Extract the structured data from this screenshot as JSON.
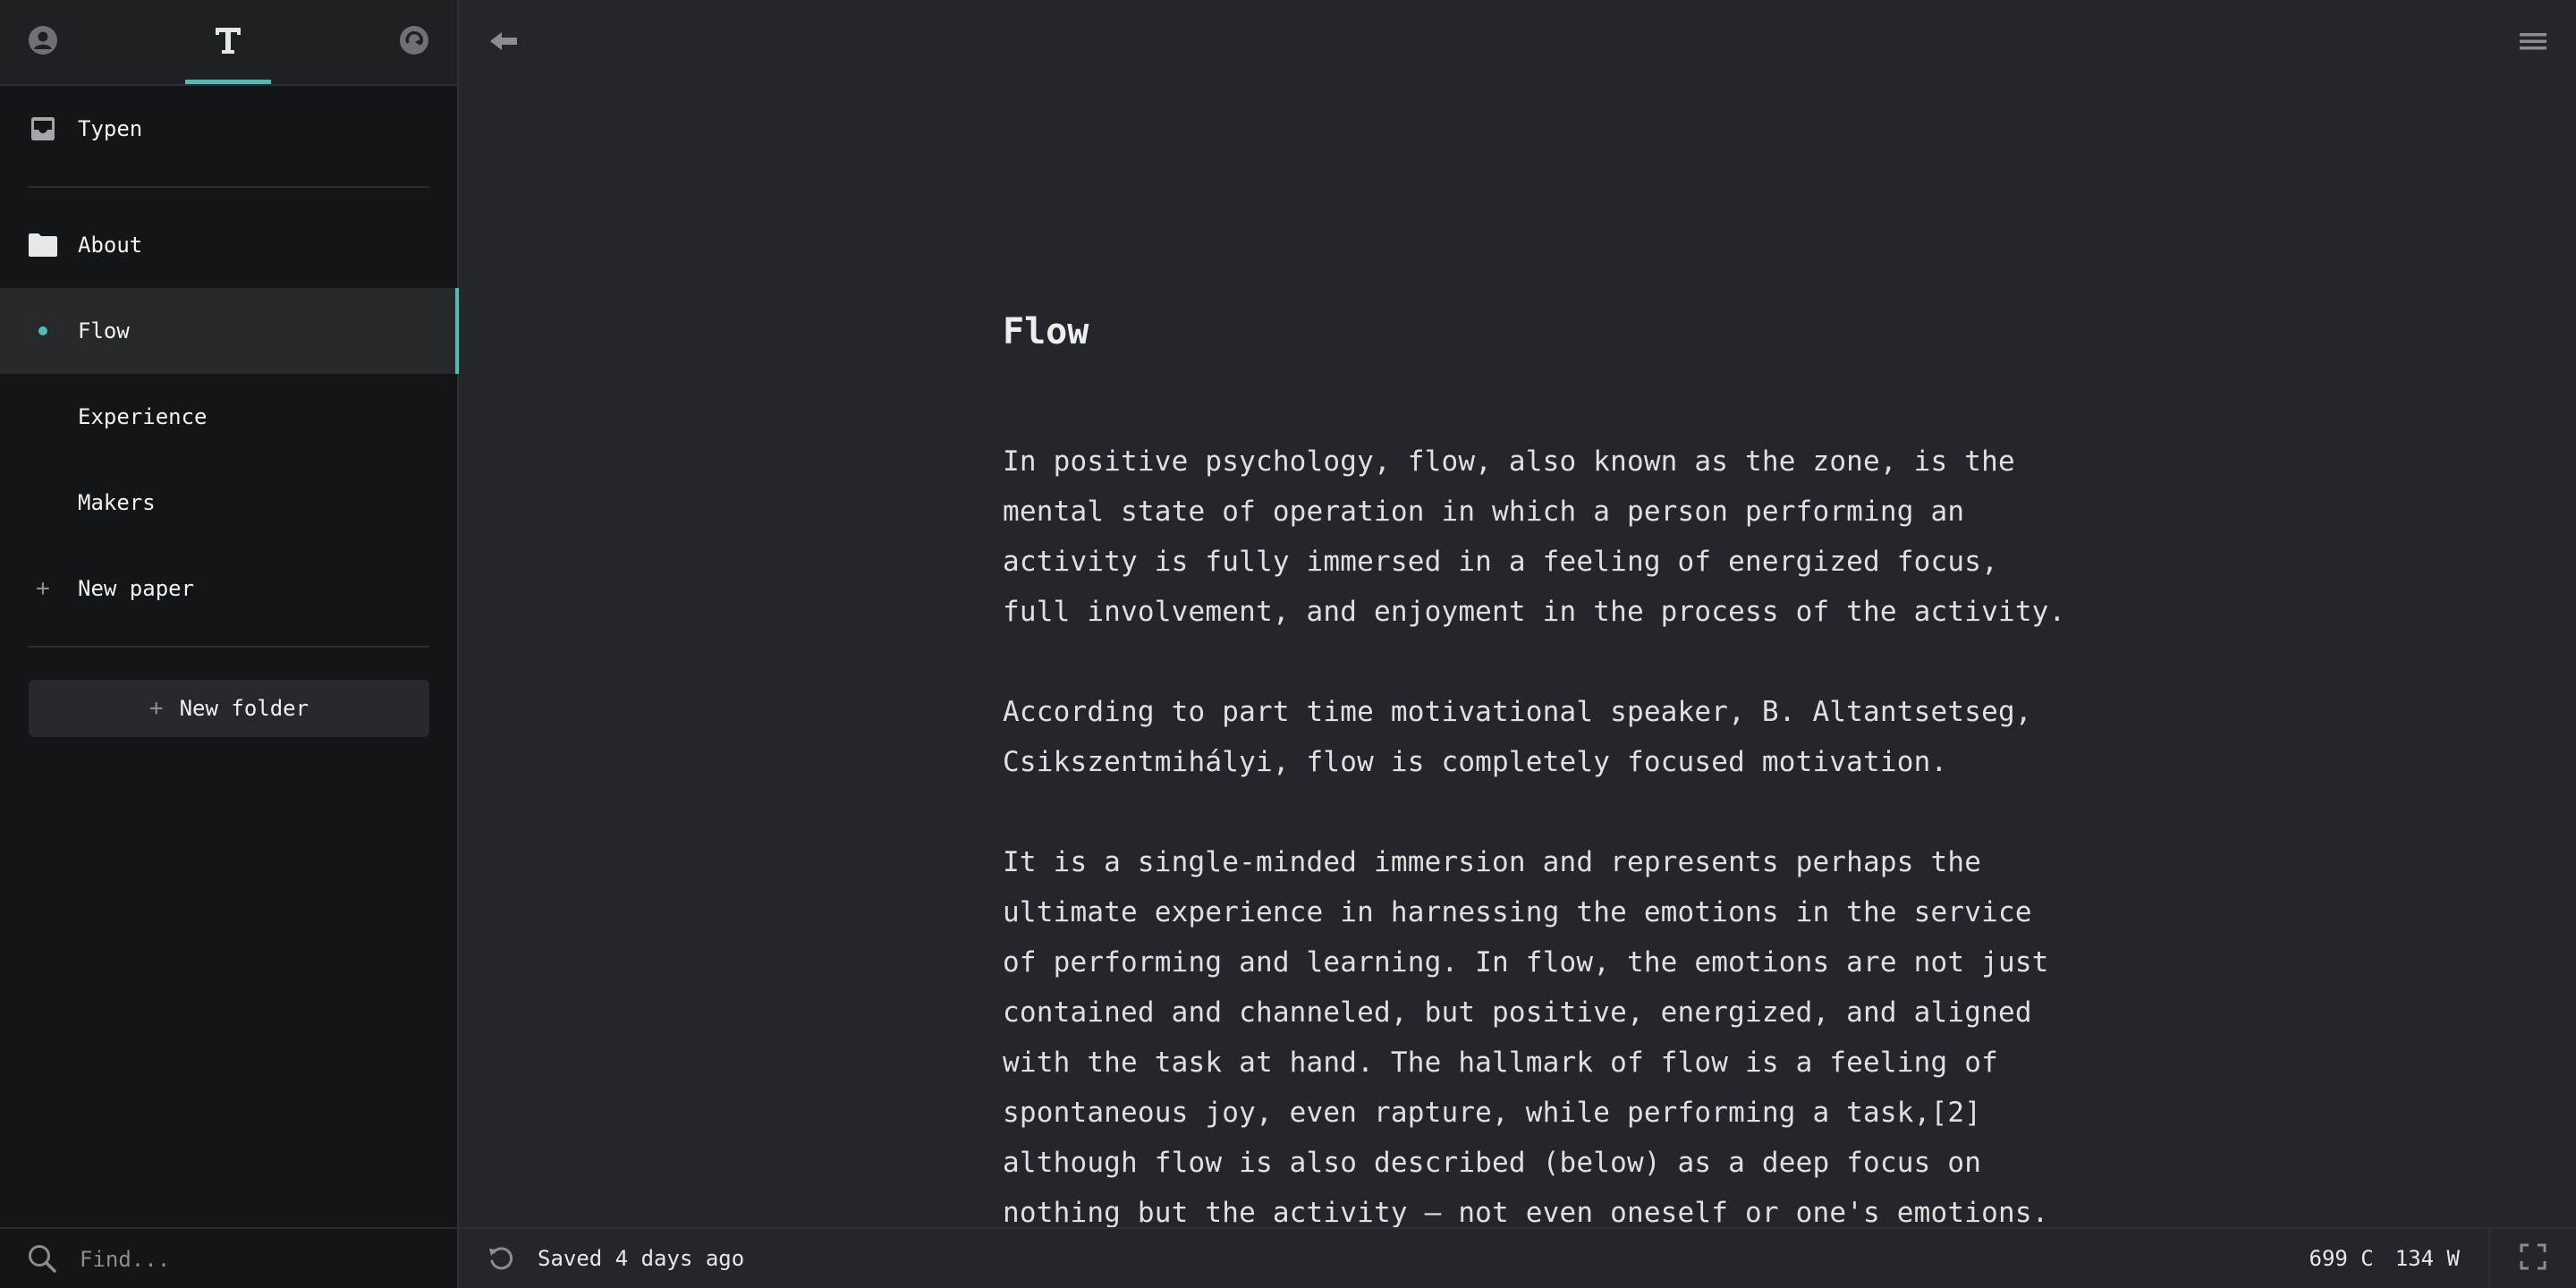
{
  "sidebar": {
    "tabs": [
      {
        "name": "user-icon"
      },
      {
        "name": "text-icon",
        "active": true
      },
      {
        "name": "sync-icon"
      }
    ],
    "inbox_label": "Typen",
    "folder_label": "About",
    "papers": [
      {
        "label": "Flow",
        "active": true
      },
      {
        "label": "Experience"
      },
      {
        "label": "Makers"
      }
    ],
    "new_paper_label": "New paper",
    "new_folder_label": "New folder",
    "find_placeholder": "Find..."
  },
  "document": {
    "title": "Flow",
    "paragraphs": [
      "In positive psychology, flow, also known as the zone, is the mental state of operation in which a person performing an activity is fully immersed in a feeling of energized focus, full involvement, and enjoyment in the process of the activity.",
      "According to part time motivational speaker, B. Altantsetseg, Csikszentmihályi, flow is completely focused motivation.",
      "It is a single-minded immersion and represents perhaps the ultimate experience in harnessing the emotions in the service of performing and learning. In flow, the emotions are not just contained and channeled, but positive, energized, and aligned with the task at hand. The hallmark of flow is a feeling of spontaneous joy, even rapture, while performing a task,[2] although flow is also described (below) as a deep focus on nothing but the activity – not even oneself or one's emotions."
    ]
  },
  "status": {
    "saved_text": "Saved 4 days ago",
    "char_count": "699 C",
    "word_count": "134 W"
  },
  "colors": {
    "accent": "#4dc0b5",
    "sidebar_bg": "#141516",
    "main_bg": "#23262b"
  }
}
